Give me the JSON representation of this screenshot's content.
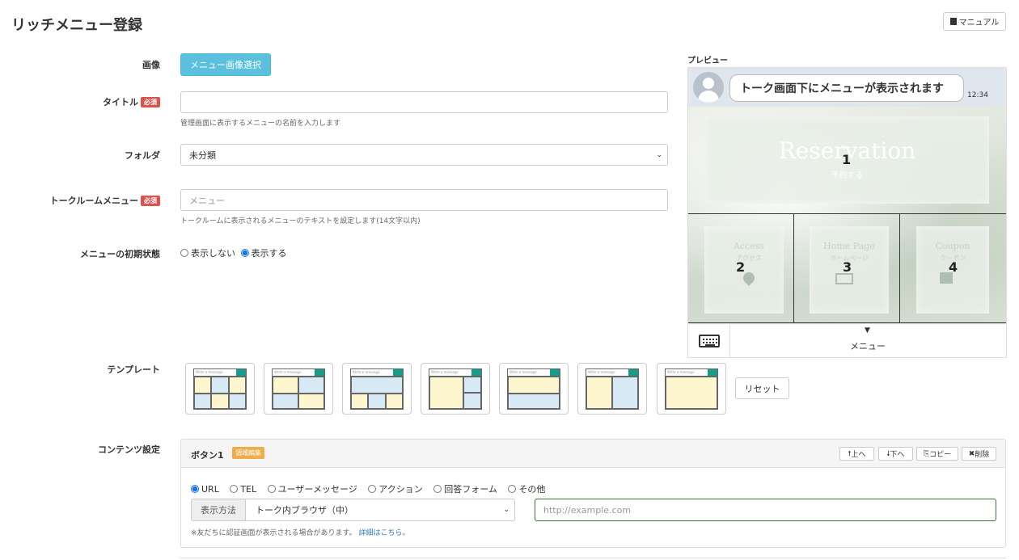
{
  "page": {
    "title": "リッチメニュー登録",
    "manual_label": "マニュアル"
  },
  "form": {
    "image_label": "画像",
    "image_button": "メニュー画像選択",
    "required_badge": "必須",
    "title_label": "タイトル",
    "title_value": "",
    "title_help": "管理画面に表示するメニューの名前を入力します",
    "folder_label": "フォルダ",
    "folder_value": "未分類",
    "talkroom_label": "トークルームメニュー",
    "talkroom_placeholder": "メニュー",
    "talkroom_help": "トークルームに表示されるメニューのテキストを設定します(14文字以内)",
    "initial_label": "メニューの初期状態",
    "initial_options": [
      "表示しない",
      "表示する"
    ],
    "initial_selected": "表示する",
    "template_label": "テンプレート",
    "reset_label": "リセット",
    "content_label": "コンテンツ設定"
  },
  "preview": {
    "label": "プレビュー",
    "bubble_text": "トーク画面下にメニューが表示されます",
    "time": "12:34",
    "menu_big_title": "Reservation",
    "menu_big_sub": "予約する",
    "areas": [
      {
        "num": "1",
        "title": "Reservation",
        "sub": "予約する"
      },
      {
        "num": "2",
        "title": "Access",
        "sub": "アクセス"
      },
      {
        "num": "3",
        "title": "Home Page",
        "sub": "ホームページ"
      },
      {
        "num": "4",
        "title": "Coupon",
        "sub": "クーポン"
      }
    ],
    "footer_menu": "メニュー"
  },
  "templates": {
    "message_hint": "Write a message",
    "count": 7
  },
  "content": {
    "panel_title": "ボタン1",
    "edit_badge": "領域編集",
    "btn_up": "上へ",
    "btn_down": "下へ",
    "btn_copy": "コピー",
    "btn_delete": "削除",
    "action_types": [
      "URL",
      "TEL",
      "ユーザーメッセージ",
      "アクション",
      "回答フォーム",
      "その他"
    ],
    "action_selected": "URL",
    "display_label": "表示方法",
    "display_value": "トーク内ブラウザ（中）",
    "url_placeholder": "http://example.com",
    "note_text": "※友だちに認証画面が表示される場合があります。",
    "note_link": "詳細はこちら。"
  }
}
